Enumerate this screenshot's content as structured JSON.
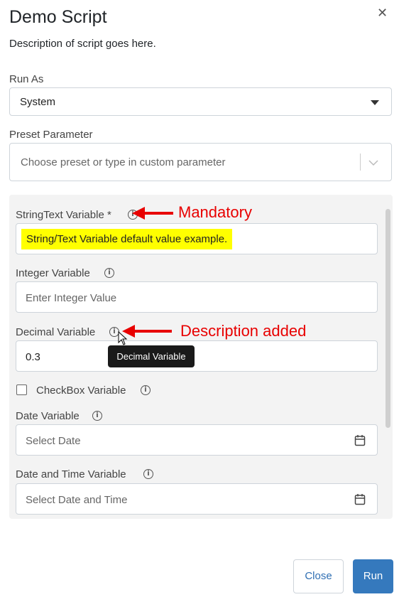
{
  "dialog": {
    "title": "Demo Script",
    "description": "Description of script goes here.",
    "close_icon": "close-icon"
  },
  "run_as": {
    "label": "Run As",
    "value": "System",
    "icon": "dropdown-caret-icon"
  },
  "preset": {
    "label": "Preset Parameter",
    "placeholder": "Choose preset or type in custom parameter",
    "icon": "chevron-down-icon"
  },
  "fields": {
    "string_text": {
      "label": "StringText Variable *",
      "value": "String/Text Variable default value example."
    },
    "integer": {
      "label": "Integer Variable",
      "placeholder": "Enter Integer Value"
    },
    "decimal": {
      "label": "Decimal Variable",
      "value": "0.3",
      "tooltip": "Decimal Variable"
    },
    "checkbox": {
      "label": "CheckBox Variable"
    },
    "date": {
      "label": "Date Variable",
      "placeholder": "Select Date"
    },
    "datetime": {
      "label": "Date and Time Variable",
      "placeholder": "Select Date and Time"
    }
  },
  "annotations": {
    "mandatory": "Mandatory",
    "description_added": "Description added"
  },
  "buttons": {
    "close": "Close",
    "run": "Run"
  },
  "colors": {
    "accent": "#3579bd",
    "annotation": "#e80000",
    "highlight": "#ffff00"
  }
}
